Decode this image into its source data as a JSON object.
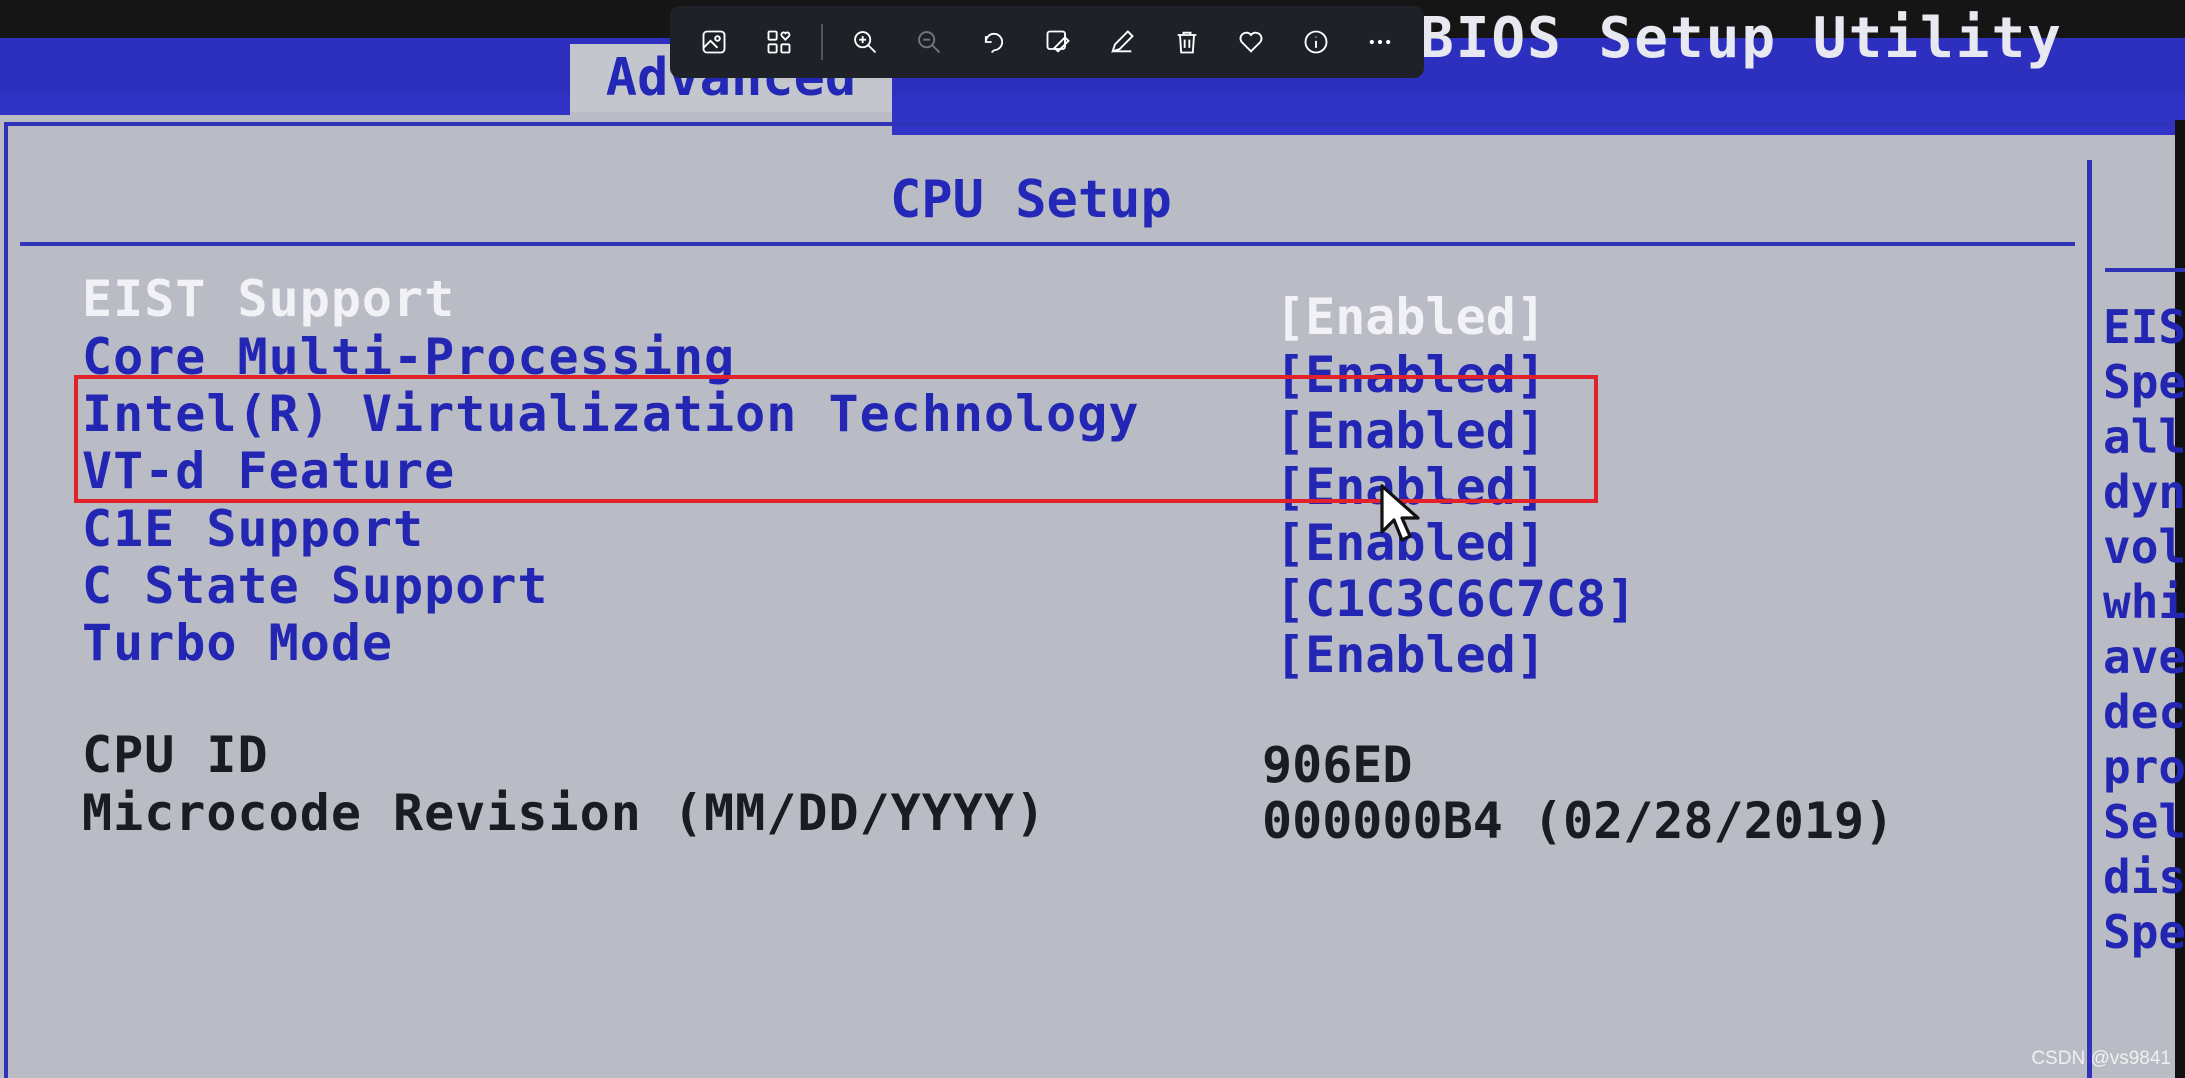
{
  "bios": {
    "title": "BIOS Setup Utility",
    "tab": "Advanced",
    "section_title": "CPU Setup",
    "options": [
      {
        "label": "EIST Support",
        "value": "[Enabled]",
        "selected": true
      },
      {
        "label": "Core Multi-Processing",
        "value": "[Enabled]",
        "selected": false
      },
      {
        "label": "Intel(R) Virtualization Technology",
        "value": "[Enabled]",
        "selected": false
      },
      {
        "label": "VT-d Feature",
        "value": "[Enabled]",
        "selected": false
      },
      {
        "label": "C1E Support",
        "value": "[Enabled]",
        "selected": false
      },
      {
        "label": "C State Support",
        "value": "[C1C3C6C7C8]",
        "selected": false
      },
      {
        "label": "Turbo Mode",
        "value": "[Enabled]",
        "selected": false
      }
    ],
    "info": [
      {
        "label": "CPU ID",
        "value": "906ED"
      },
      {
        "label": "Microcode Revision (MM/DD/YYYY)",
        "value": "000000B4 (02/28/2019)"
      }
    ],
    "help_lines": [
      "EIS",
      "Spe",
      "all",
      "dyn",
      "vol",
      "whi",
      "ave",
      "dec",
      "pro",
      "Sel",
      "dis",
      "Spe"
    ]
  },
  "viewer_toolbar": {
    "buttons": [
      {
        "icon": "image-icon"
      },
      {
        "icon": "grid-heart-icon"
      },
      {
        "icon": "zoom-in-icon"
      },
      {
        "icon": "zoom-out-icon"
      },
      {
        "icon": "rotate-icon"
      },
      {
        "icon": "edit-image-icon"
      },
      {
        "icon": "draw-icon"
      },
      {
        "icon": "delete-icon"
      },
      {
        "icon": "heart-icon"
      },
      {
        "icon": "info-icon"
      },
      {
        "icon": "more-icon"
      }
    ]
  },
  "watermark": "CSDN @vs9841",
  "colors": {
    "bios_blue": "#2326b3",
    "bios_bg": "#b9bcc4",
    "highlight": "#e1222a"
  }
}
